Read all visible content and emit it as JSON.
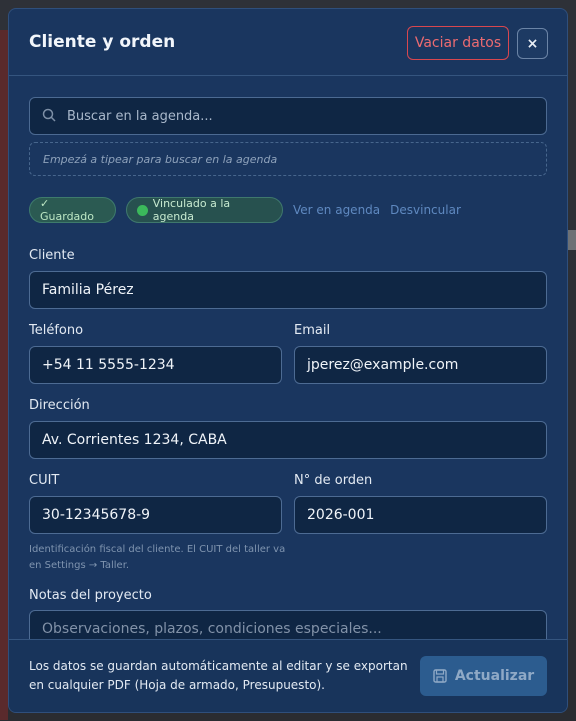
{
  "modal": {
    "title": "Cliente y orden",
    "clear_label": "Vaciar datos",
    "close_label": "×"
  },
  "search": {
    "placeholder": "Buscar en la agenda...",
    "hint": "Empezá a tipear para buscar en la agenda"
  },
  "status": {
    "saved": "✓ Guardado",
    "linked": "Vinculado a la agenda",
    "view_link": "Ver en agenda",
    "unlink": "Desvincular"
  },
  "form": {
    "client_label": "Cliente",
    "client_value": "Familia Pérez",
    "phone_label": "Teléfono",
    "phone_value": "+54 11 5555-1234",
    "email_label": "Email",
    "email_value": "jperez@example.com",
    "address_label": "Dirección",
    "address_value": "Av. Corrientes 1234, CABA",
    "cuit_label": "CUIT",
    "cuit_value": "30-12345678-9",
    "order_label": "N° de orden",
    "order_value": "2026-001",
    "cuit_help": "Identificación fiscal del cliente. El CUIT del taller va en Settings → Taller.",
    "notes_label": "Notas del proyecto",
    "notes_placeholder": "Observaciones, plazos, condiciones especiales..."
  },
  "footer": {
    "info": "Los datos se guardan automáticamente al editar y se exportan en cualquier PDF (Hoja de armado, Presupuesto).",
    "update_label": "Actualizar"
  }
}
